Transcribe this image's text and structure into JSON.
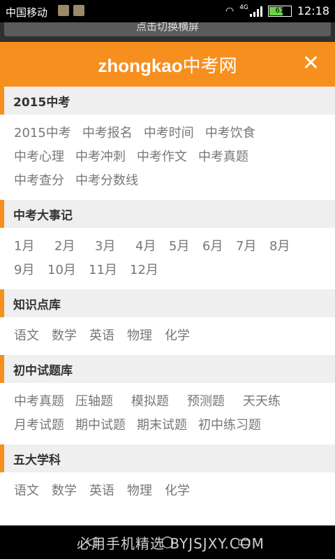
{
  "status": {
    "carrier": "中国移动",
    "network": "4G",
    "battery": "61",
    "time": "12:18"
  },
  "rotate_button": "点击切换横屏",
  "header": {
    "logo_en": "zhongkao",
    "logo_cn": "中考网",
    "close": "✕"
  },
  "sections": [
    {
      "title": "2015中考",
      "links": [
        "2015中考",
        "中考报名",
        "中考时间",
        "中考饮食",
        "中考心理",
        "中考冲刺",
        "中考作文",
        "中考真题",
        "中考查分",
        "中考分数线"
      ]
    },
    {
      "title": "中考大事记",
      "links": [
        "1月",
        "2月",
        "3月",
        "4月",
        "5月",
        "6月",
        "7月",
        "8月",
        "9月",
        "10月",
        "11月",
        "12月"
      ]
    },
    {
      "title": "知识点库",
      "links": [
        "语文",
        "数学",
        "英语",
        "物理",
        "化学"
      ]
    },
    {
      "title": "初中试题库",
      "links": [
        "中考真题",
        "压轴题",
        "模拟题",
        "预测题",
        "天天练",
        "月考试题",
        "期中试题",
        "期末试题",
        "初中练习题"
      ]
    },
    {
      "title": "五大学科",
      "links": [
        "语文",
        "数学",
        "英语",
        "物理",
        "化学"
      ]
    }
  ],
  "bottom_bar": {
    "watermark": "必用手机精选 BYJSJXY.COM",
    "icons": [
      "back-icon",
      "home-icon",
      "recent-apps-icon"
    ]
  }
}
